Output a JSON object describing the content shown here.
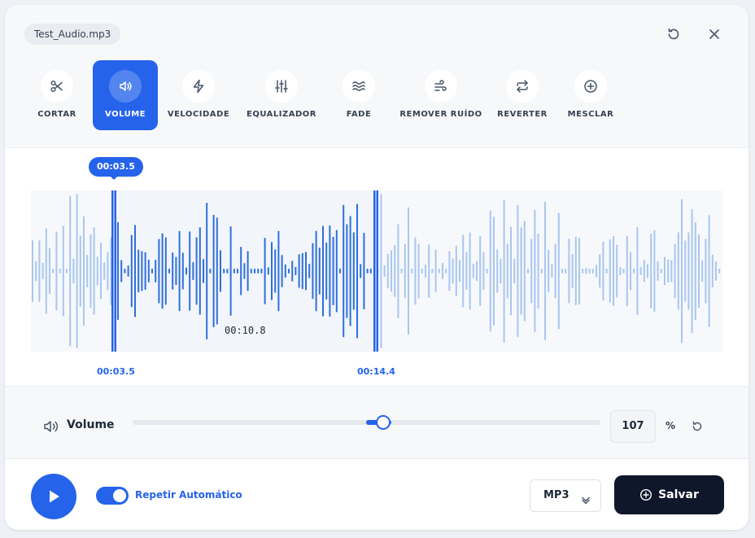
{
  "file": {
    "name": "Test_Audio.mp3"
  },
  "header": {
    "icons": [
      "undo-icon",
      "close-icon"
    ]
  },
  "toolbar": {
    "active": "volume",
    "tools": [
      {
        "id": "cortar",
        "label": "CORTAR",
        "icon": "scissors-icon"
      },
      {
        "id": "volume",
        "label": "VOLUME",
        "icon": "speaker-icon"
      },
      {
        "id": "velocidade",
        "label": "VELOCIDADE",
        "icon": "bolt-icon"
      },
      {
        "id": "equalizador",
        "label": "EQUALIZADOR",
        "icon": "sliders-icon"
      },
      {
        "id": "fade",
        "label": "FADE",
        "icon": "waves-icon"
      },
      {
        "id": "remover_ruido",
        "label": "REMOVER RUÍDO",
        "icon": "wind-icon"
      },
      {
        "id": "reverter",
        "label": "REVERTER",
        "icon": "repeat-icon"
      },
      {
        "id": "mesclar",
        "label": "MESCLAR",
        "icon": "plus-circle-icon"
      }
    ]
  },
  "waveform": {
    "selection_bubble": "00:03.5",
    "selection_duration": "00:10.8",
    "start_time": "00:03.5",
    "end_time": "00:14.4",
    "colors": {
      "selected": "#2f6fdb",
      "unselected": "#a9c6f0",
      "handle": "#2563eb",
      "selection_bg": "#f2f5fa"
    }
  },
  "volume": {
    "label": "Volume",
    "value": "107",
    "unit": "%",
    "slider_fraction": 0.535,
    "icon": "speaker-icon"
  },
  "footer": {
    "autorepeat_label": "Repetir Automático",
    "autorepeat_on": true,
    "format": "MP3",
    "save_label": "Salvar",
    "colors": {
      "accent": "#2563eb",
      "save_bg": "#0f172a"
    }
  }
}
